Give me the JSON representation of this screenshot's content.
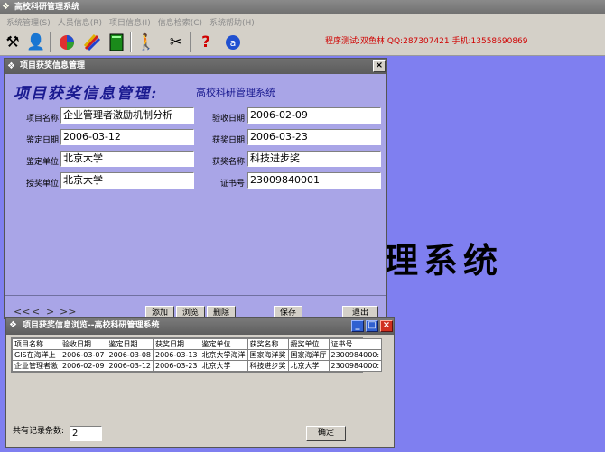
{
  "app": {
    "title": "高校科研管理系统",
    "menus": [
      "系统管理(S)",
      "人员信息(R)",
      "项目信息(I)",
      "信息检索(C)",
      "系统帮助(H)"
    ],
    "contact": "程序测试:双鱼林 QQ:287307421 手机:13558690869",
    "background_watermark": "理系统",
    "toolbar_icons": [
      "tools-icon",
      "user-check-icon",
      "pie-chart-icon",
      "pencils-icon",
      "book-icon",
      "person-walk-icon",
      "scissors-icon",
      "help-icon",
      "info-icon"
    ]
  },
  "award_form": {
    "window_title": "项目获奖信息管理",
    "header": "项目获奖信息管理:",
    "subtitle": "高校科研管理系统",
    "fields": {
      "project_name": {
        "label": "项目名称",
        "value": "企业管理者激励机制分析"
      },
      "acceptance_date": {
        "label": "验收日期",
        "value": "2006-02-09"
      },
      "appraisal_date": {
        "label": "鉴定日期",
        "value": "2006-03-12"
      },
      "award_date": {
        "label": "获奖日期",
        "value": "2006-03-23"
      },
      "appraisal_unit": {
        "label": "鉴定单位",
        "value": "北京大学"
      },
      "award_name": {
        "label": "获奖名称",
        "value": "科技进步奖"
      },
      "grant_unit": {
        "label": "授奖单位",
        "value": "北京大学"
      },
      "certificate_no": {
        "label": "证书号",
        "value": "23009840001"
      }
    },
    "nav": [
      "<<",
      "<",
      ">",
      ">>"
    ],
    "buttons": {
      "add": "添加",
      "browse": "浏览",
      "delete": "删除",
      "save": "保存",
      "exit": "退出"
    }
  },
  "browse_window": {
    "title": "项目获奖信息浏览--高校科研管理系统",
    "columns": [
      "项目名称",
      "验收日期",
      "鉴定日期",
      "获奖日期",
      "鉴定单位",
      "获奖名称",
      "授奖单位",
      "证书号"
    ],
    "rows": [
      [
        "GIS在海洋上",
        "2006-03-07",
        "2006-03-08",
        "2006-03-13",
        "北京大学海洋",
        "国家海洋奖",
        "国家海洋厅",
        "2300984000:"
      ],
      [
        "企业管理者激",
        "2006-02-09",
        "2006-03-12",
        "2006-03-23",
        "北京大学",
        "科技进步奖",
        "北京大学",
        "2300984000:"
      ]
    ],
    "record_count_label": "共有记录条数:",
    "record_count": "2",
    "ok_button": "确定"
  }
}
